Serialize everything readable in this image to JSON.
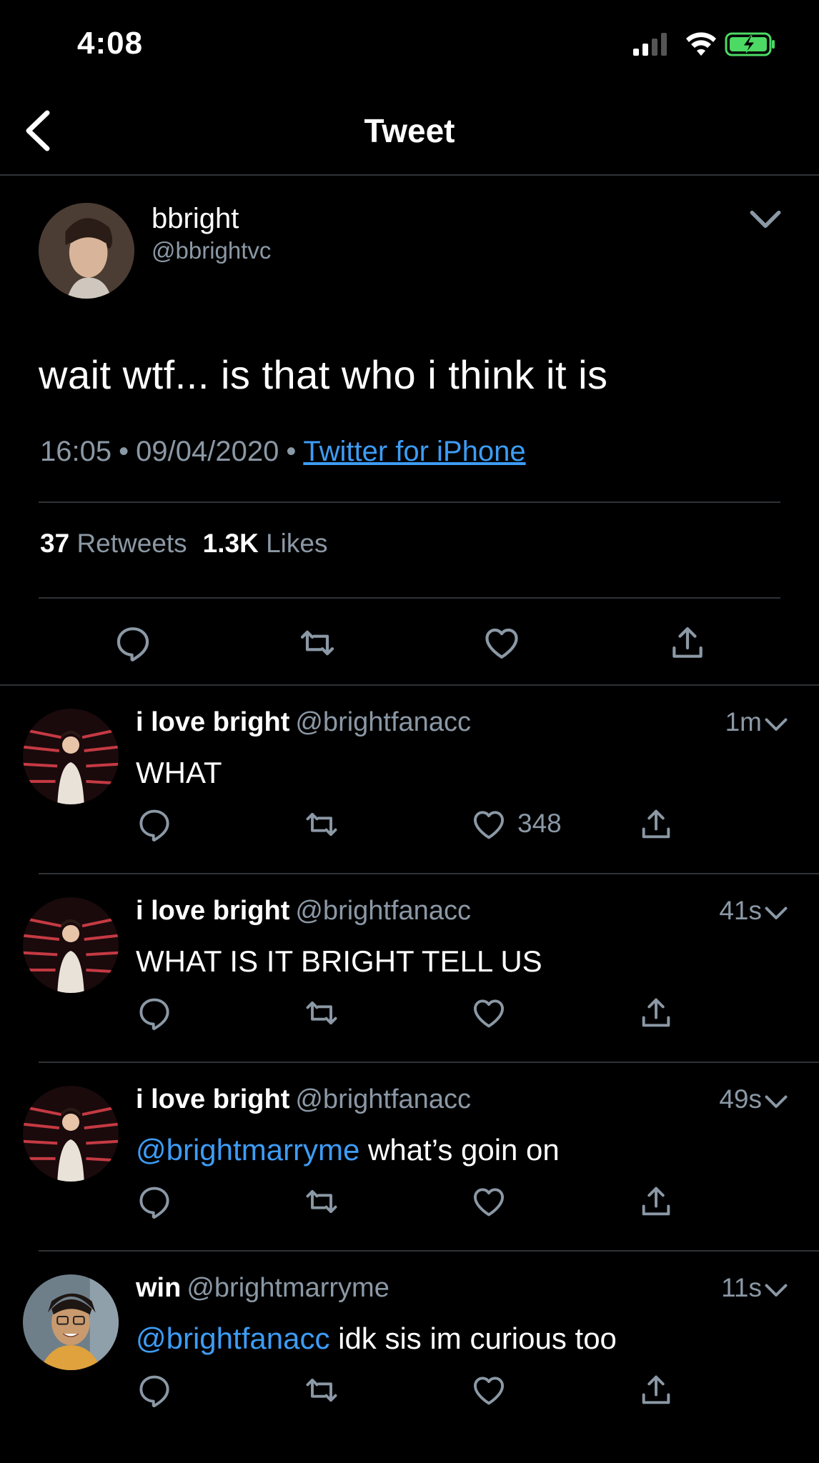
{
  "status_bar": {
    "time": "4:08"
  },
  "nav": {
    "title": "Tweet"
  },
  "tweet": {
    "author_name": "bbright",
    "author_handle": "@bbrightvc",
    "text": "wait wtf... is that who i think it is",
    "time": "16:05",
    "date": "09/04/2020",
    "separator": "•",
    "source": "Twitter for iPhone",
    "retweet_count": "37",
    "retweet_label": "Retweets",
    "like_count": "1.3K",
    "like_label": "Likes"
  },
  "replies": [
    {
      "name": "i love bright",
      "handle": "@brightfanacc",
      "time": "1m",
      "mention": "",
      "text": "WHAT",
      "likes": "348",
      "avatar": "red-lights-photo"
    },
    {
      "name": "i love bright",
      "handle": "@brightfanacc",
      "time": "41s",
      "mention": "",
      "text": "WHAT IS IT BRIGHT TELL US",
      "likes": "",
      "avatar": "red-lights-photo"
    },
    {
      "name": "i love bright",
      "handle": "@brightfanacc",
      "time": "49s",
      "mention": "@brightmarryme",
      "text": " what’s goin on",
      "likes": "",
      "avatar": "red-lights-photo"
    },
    {
      "name": "win",
      "handle": "@brightmarryme",
      "time": "11s",
      "mention": "@brightfanacc",
      "text": " idk sis im curious too",
      "likes": "",
      "avatar": "smiling-person-photo"
    }
  ],
  "icons": {
    "reply": "reply-icon",
    "retweet": "retweet-icon",
    "like": "heart-icon",
    "share": "share-icon"
  },
  "colors": {
    "background": "#000000",
    "link": "#3d9cf5",
    "muted": "#8b98a5",
    "divider": "#2f3336",
    "battery": "#4cd964"
  }
}
